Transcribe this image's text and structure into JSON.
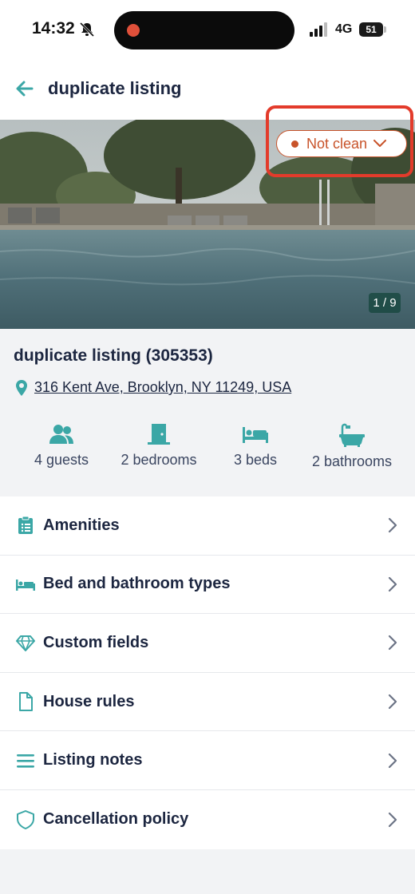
{
  "status_bar": {
    "time": "14:32",
    "network": "4G",
    "battery": "51"
  },
  "header": {
    "title": "duplicate listing"
  },
  "hero": {
    "cleaning_status": "Not clean",
    "photo_counter": "1 / 9"
  },
  "listing": {
    "name": "duplicate listing (305353)",
    "address": "316 Kent Ave, Brooklyn, NY 11249, USA",
    "stats": [
      {
        "icon": "guests-icon",
        "label": "4 guests"
      },
      {
        "icon": "bedroom-door-icon",
        "label": "2 bedrooms"
      },
      {
        "icon": "bed-icon",
        "label": "3 beds"
      },
      {
        "icon": "bathtub-icon",
        "label": "2 bathrooms"
      }
    ]
  },
  "menu": {
    "items": [
      {
        "icon": "clipboard-icon",
        "label": "Amenities"
      },
      {
        "icon": "bed-icon",
        "label": "Bed and bathroom types"
      },
      {
        "icon": "diamond-icon",
        "label": "Custom fields"
      },
      {
        "icon": "document-icon",
        "label": "House rules"
      },
      {
        "icon": "list-icon",
        "label": "Listing notes"
      },
      {
        "icon": "shield-icon",
        "label": "Cancellation policy"
      }
    ]
  },
  "colors": {
    "accent": "#3ba7a6",
    "status": "#c8532a",
    "text": "#1c2640",
    "highlight": "#e33b2b"
  }
}
